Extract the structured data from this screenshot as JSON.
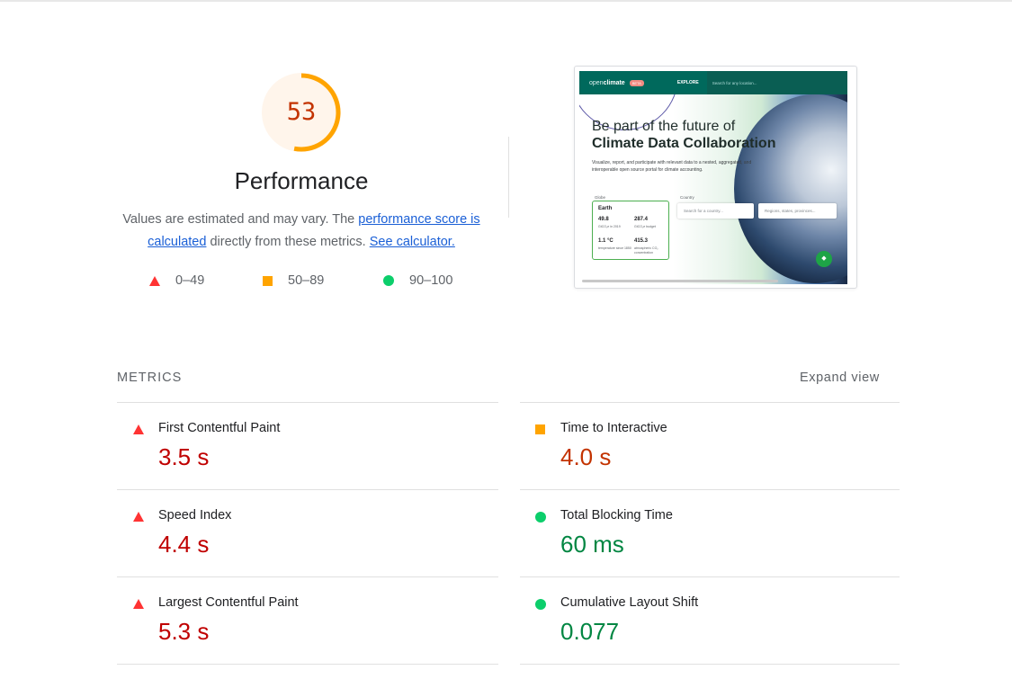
{
  "performance": {
    "score": "53",
    "score_fraction": 0.53,
    "title": "Performance",
    "desc_prefix": "Values are estimated and may vary. The ",
    "desc_link1": "performance score is calculated",
    "desc_middle": " directly from these metrics. ",
    "desc_link2": "See calculator.",
    "colors": {
      "gauge_arc": "#ffa400",
      "gauge_bg": "#fff5eb",
      "score_text": "#c33300"
    }
  },
  "legend": [
    {
      "shape": "triangle",
      "range": "0–49",
      "color": "#ff3333"
    },
    {
      "shape": "square",
      "range": "50–89",
      "color": "#ffa400"
    },
    {
      "shape": "circle",
      "range": "90–100",
      "color": "#0cce6b"
    }
  ],
  "screenshot": {
    "logo_open": "open",
    "logo_climate": "climate",
    "beta": "BETA",
    "explore": "EXPLORE",
    "search_placeholder": "Search for any location...",
    "heading1": "Be part of the future of",
    "heading2": "Climate Data Collaboration",
    "subtext": "Visualize, report, and participate with relevant data to a nested, aggregated, and interoperable open source portal for climate accounting.",
    "label_globe": "Globe",
    "label_country": "Country",
    "card_title": "Earth",
    "stat1_value": "49.8",
    "stat1_unit": "GtCO₂e in 2019",
    "stat2_value": "287.4",
    "stat2_unit": "GtCO₂e budget",
    "stat3_value": "1.1 °C",
    "stat3_unit": "temperature since 1850",
    "stat4_value": "415.3",
    "stat4_unit": "atmospheric CO₂ concentration",
    "country_placeholder": "Search for a country...",
    "region_placeholder": "Regions, states, provinces..."
  },
  "metrics": {
    "heading": "METRICS",
    "expand_label": "Expand view",
    "items": [
      {
        "name": "First Contentful Paint",
        "value": "3.5 s",
        "status": "fail"
      },
      {
        "name": "Time to Interactive",
        "value": "4.0 s",
        "status": "average"
      },
      {
        "name": "Speed Index",
        "value": "4.4 s",
        "status": "fail"
      },
      {
        "name": "Total Blocking Time",
        "value": "60 ms",
        "status": "pass"
      },
      {
        "name": "Largest Contentful Paint",
        "value": "5.3 s",
        "status": "fail"
      },
      {
        "name": "Cumulative Layout Shift",
        "value": "0.077",
        "status": "pass"
      }
    ]
  }
}
